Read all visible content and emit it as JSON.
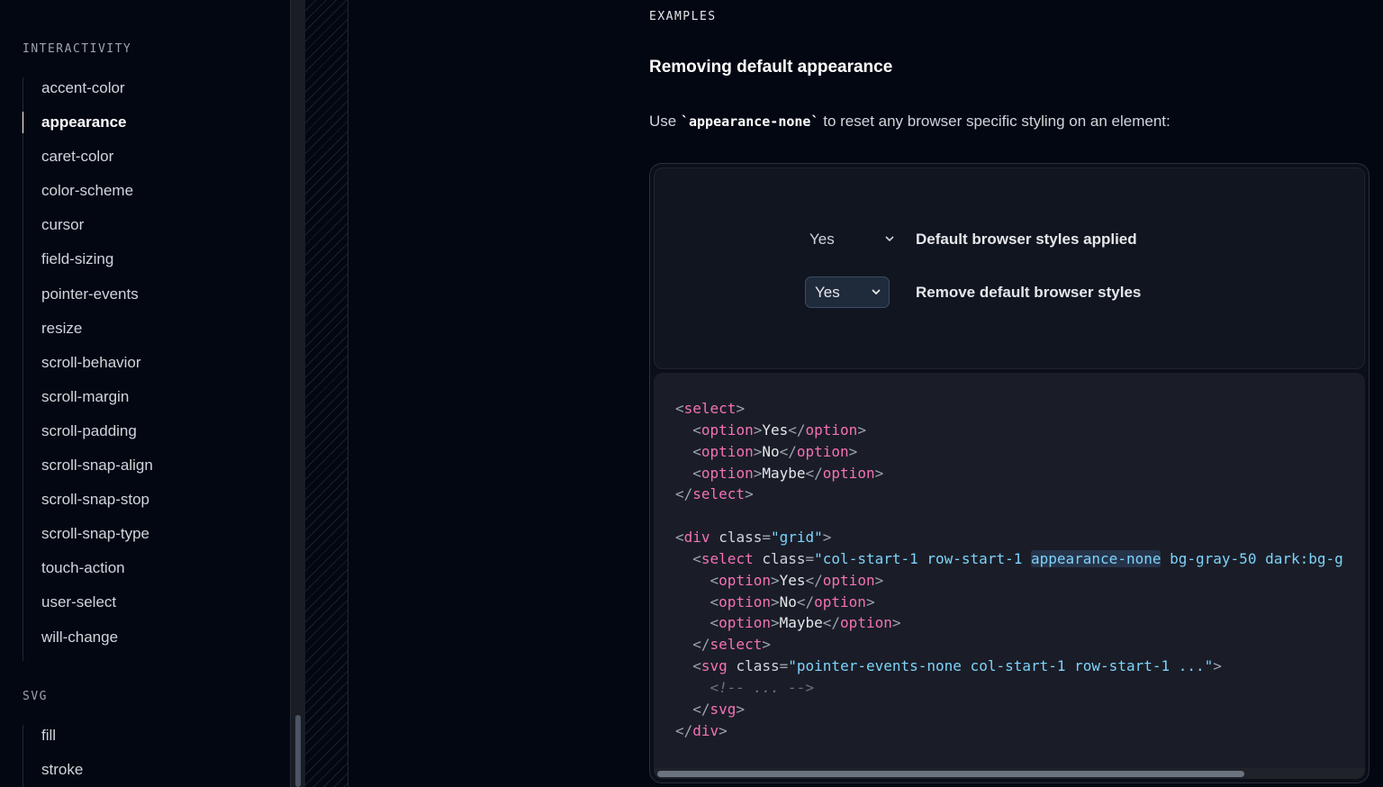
{
  "sidebar": {
    "sections": [
      {
        "heading": "INTERACTIVITY",
        "items": [
          {
            "label": "accent-color",
            "active": false
          },
          {
            "label": "appearance",
            "active": true
          },
          {
            "label": "caret-color",
            "active": false
          },
          {
            "label": "color-scheme",
            "active": false
          },
          {
            "label": "cursor",
            "active": false
          },
          {
            "label": "field-sizing",
            "active": false
          },
          {
            "label": "pointer-events",
            "active": false
          },
          {
            "label": "resize",
            "active": false
          },
          {
            "label": "scroll-behavior",
            "active": false
          },
          {
            "label": "scroll-margin",
            "active": false
          },
          {
            "label": "scroll-padding",
            "active": false
          },
          {
            "label": "scroll-snap-align",
            "active": false
          },
          {
            "label": "scroll-snap-stop",
            "active": false
          },
          {
            "label": "scroll-snap-type",
            "active": false
          },
          {
            "label": "touch-action",
            "active": false
          },
          {
            "label": "user-select",
            "active": false
          },
          {
            "label": "will-change",
            "active": false
          }
        ]
      },
      {
        "heading": "SVG",
        "items": [
          {
            "label": "fill",
            "active": false
          },
          {
            "label": "stroke",
            "active": false
          }
        ]
      }
    ]
  },
  "main": {
    "eyebrow": "EXAMPLES",
    "heading": "Removing default appearance",
    "intro": {
      "before": "Use ",
      "code": "`appearance-none`",
      "after": " to reset any browser specific styling on an element:"
    },
    "demo": {
      "default_select_value": "Yes",
      "default_label": "Default browser styles applied",
      "styled_select_value": "Yes",
      "styled_label": "Remove default browser styles"
    }
  },
  "colors": {
    "background": "#030712",
    "tag": "#f472b6",
    "string": "#7dd3fc",
    "highlight": "#26344a"
  },
  "icons": [
    "chevron-down-icon"
  ]
}
